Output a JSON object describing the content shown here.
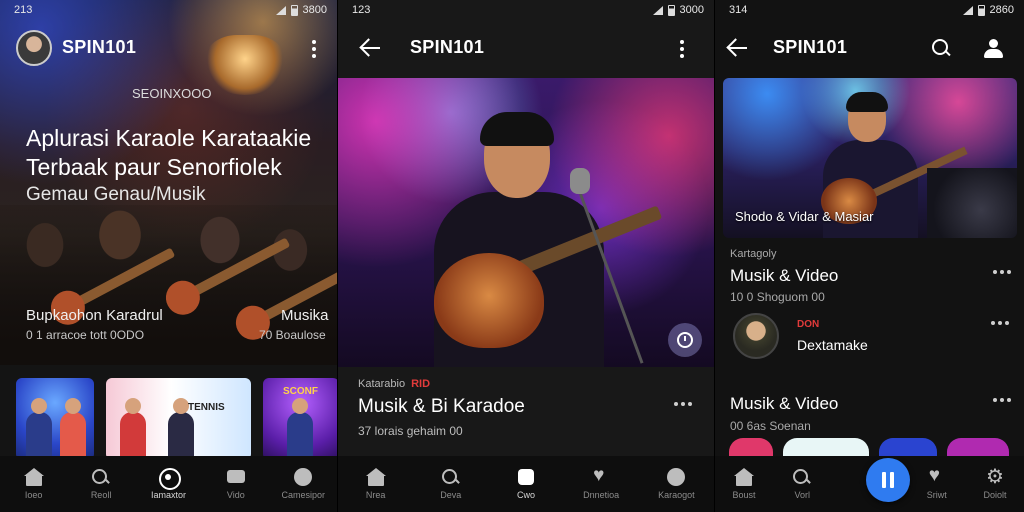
{
  "screen1": {
    "status": {
      "time": "213",
      "right": "3800"
    },
    "brand": "SPIN101",
    "kicker": "SEOINXOOO",
    "title": "Aplurasi Karaole Karataakie Terbaak paur Senorfiolek",
    "subtitle": "Gemau Genau/Musik",
    "card_left": {
      "caption": "Bupkaohon Karadrul",
      "meta": "0 1 arracoe tott 0ODO"
    },
    "card_right": {
      "caption": "Musika",
      "meta": "70 Boaulose"
    },
    "thumb_label": "TENNIS",
    "thumb3_label": "SCONF",
    "nav": [
      {
        "label": "Ioeo",
        "icon": "home-icon"
      },
      {
        "label": "Reoll",
        "icon": "search-icon"
      },
      {
        "label": "Iamaxtor",
        "icon": "record-icon"
      },
      {
        "label": "Vido",
        "icon": "message-icon"
      },
      {
        "label": "Camesipor",
        "icon": "face-icon"
      }
    ]
  },
  "screen2": {
    "status": {
      "time": "123",
      "right": "3000"
    },
    "brand": "SPIN101",
    "category": "Katarabio",
    "badge": "RID",
    "title": "Musik & Bi Karadoe",
    "meta": "37 lorais gehaim 00",
    "nav": [
      {
        "label": "Nrea",
        "icon": "home-icon"
      },
      {
        "label": "Deva",
        "icon": "search-icon"
      },
      {
        "label": "Cwo",
        "icon": "cube-icon"
      },
      {
        "label": "Dnnetioa",
        "icon": "heart-icon"
      },
      {
        "label": "Karaogot",
        "icon": "face-icon"
      }
    ]
  },
  "screen3": {
    "status": {
      "time": "314",
      "right": "2860"
    },
    "brand": "SPIN101",
    "hero_caption": "Shodo & Vidar & Masiar",
    "kicker": "Kartagoly",
    "section1_title": "Musik & Video",
    "section1_meta": "10 0 Shoguom 00",
    "badge": "DON",
    "artist": "Dextamake",
    "section2_title": "Musik & Video",
    "section2_meta": "00 6as Soenan",
    "nav": [
      {
        "label": "Boust",
        "icon": "home-icon"
      },
      {
        "label": "Vorl",
        "icon": "search-icon"
      },
      {
        "label": "Sriwt",
        "icon": "heart-icon"
      },
      {
        "label": "Doiolt",
        "icon": "gear-icon"
      }
    ]
  }
}
